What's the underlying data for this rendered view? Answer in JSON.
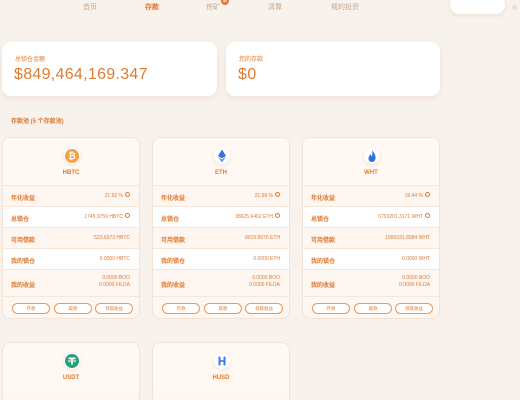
{
  "nav": {
    "items": [
      {
        "label": "首页"
      },
      {
        "label": "存款"
      },
      {
        "label": "挖矿"
      },
      {
        "label": "清算"
      },
      {
        "label": "我的投资"
      }
    ],
    "badge": "新"
  },
  "stats": {
    "total_label": "总锁仓金额",
    "total_value": "$849,464,169.347",
    "my_label": "您的存款",
    "my_value": "$0"
  },
  "section": {
    "title": "存款池 (5 个存款池)"
  },
  "row_labels": {
    "apy": "年化收益",
    "tvl": "总锁仓",
    "borrow": "可用借款",
    "locked": "我的锁仓",
    "earnings": "我的收益"
  },
  "buttons": {
    "deposit": "存款",
    "withdraw": "取款",
    "claim": "领取收益"
  },
  "pools": [
    {
      "name": "HBTC",
      "icon": "bitcoin-icon",
      "apy": "21.92 %",
      "tvl": "1745.9750 HBTC",
      "borrow": "523.6973 HBTC",
      "locked": "0.0000 HBTC",
      "earn_boo": "0.0000 BOO",
      "earn_filda": "0.0000 FILDA"
    },
    {
      "name": "ETH",
      "icon": "ethereum-icon",
      "apy": "21.69 %",
      "tvl": "38625.6402 ETH",
      "borrow": "8019.8976 ETH",
      "locked": "0.0000 ETH",
      "earn_boo": "0.0000 BOO",
      "earn_filda": "0.0000 FILDA"
    },
    {
      "name": "WHT",
      "icon": "heco-flame-icon",
      "apy": "19.44 %",
      "tvl": "6793201.3171 WHT",
      "borrow": "1890331.8984 WHT",
      "locked": "0.0000 WHT",
      "earn_boo": "0.0000 BOO",
      "earn_filda": "0.0000 FILDA"
    },
    {
      "name": "USDT",
      "icon": "tether-icon"
    },
    {
      "name": "HUSD",
      "icon": "husd-icon"
    }
  ],
  "colors": {
    "accent": "#e07a32",
    "background": "#f8f2ec",
    "card": "#ffffff",
    "pool_bg": "#fdf6f1"
  }
}
